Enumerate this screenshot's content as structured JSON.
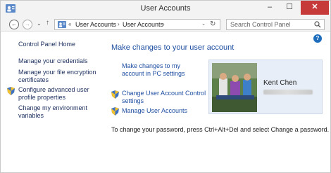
{
  "window": {
    "title": "User Accounts",
    "minimize_glyph": "–",
    "maximize_glyph": "☐",
    "close_glyph": "✕"
  },
  "nav": {
    "back_glyph": "←",
    "forward_glyph": "→",
    "recent_glyph": "⌄",
    "up_glyph": "↑",
    "breadcrumb_overflow": "«",
    "breadcrumbs": [
      "User Accounts",
      "User Accounts"
    ],
    "separator": "›",
    "address_dropdown_glyph": "⌄",
    "refresh_glyph": "↻",
    "search_placeholder": "Search Control Panel",
    "help_glyph": "?"
  },
  "left_pane": {
    "items": [
      {
        "label": "Control Panel Home",
        "shield": false
      },
      {
        "label": "Manage your credentials",
        "shield": false
      },
      {
        "label": "Manage your file encryption certificates",
        "shield": false
      },
      {
        "label": "Configure advanced user profile properties",
        "shield": true
      },
      {
        "label": "Change my environment variables",
        "shield": false
      }
    ]
  },
  "main": {
    "heading": "Make changes to your user account",
    "links": [
      {
        "label": "Make changes to my account in PC settings",
        "shield": false
      },
      {
        "label": "Change User Account Control settings",
        "shield": true
      },
      {
        "label": "Manage User Accounts",
        "shield": true
      }
    ],
    "account": {
      "name": "Kent Chen"
    },
    "note": "To change your password, press Ctrl+Alt+Del and select Change a password."
  },
  "colors": {
    "link": "#1e4ea1",
    "close_button": "#c73a3a",
    "card_background": "#e8eef7"
  },
  "icons": [
    "user-accounts-icon",
    "shield-icon",
    "search-icon",
    "help-icon",
    "refresh-icon"
  ]
}
